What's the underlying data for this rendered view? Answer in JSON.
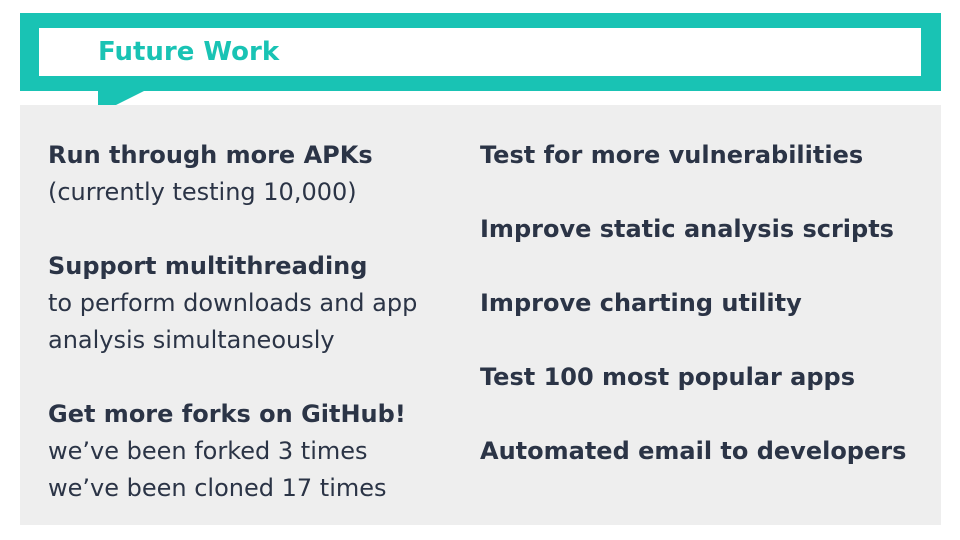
{
  "slide": {
    "title": "Future Work",
    "left_items": [
      {
        "heading": "Run through more APKs",
        "lines": [
          "(currently testing 10,000)"
        ]
      },
      {
        "heading": "Support multithreading",
        "lines": [
          "to perform downloads and app",
          "analysis simultaneously"
        ]
      },
      {
        "heading": "Get more forks on GitHub!",
        "lines": [
          "we’ve been forked 3 times",
          "we’ve been cloned 17 times"
        ]
      }
    ],
    "right_items": [
      "Test for more vulnerabilities",
      "Improve static analysis scripts",
      "Improve charting utility",
      "Test 100 most popular apps",
      "Automated email to developers"
    ]
  },
  "colors": {
    "accent": "#19c3b4",
    "panel": "#eeeeee",
    "text": "#2b3446"
  }
}
